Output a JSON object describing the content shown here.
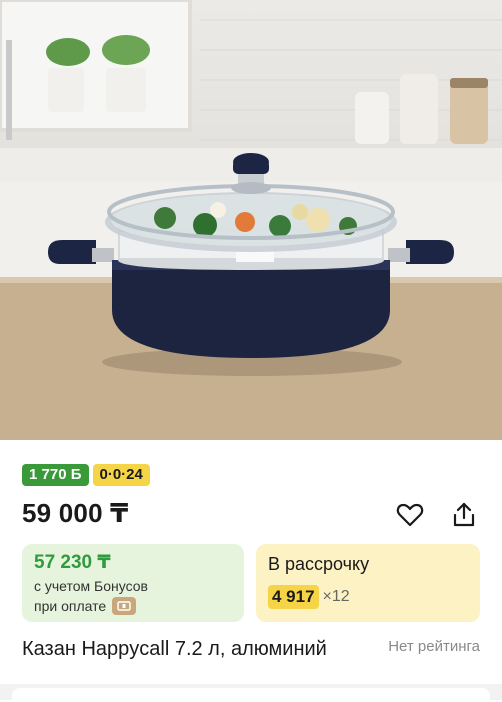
{
  "product": {
    "image_alt": "",
    "badges": [
      {
        "label": "1 770 Б"
      },
      {
        "label": "0·0·24"
      }
    ],
    "price": "59 000 ₸",
    "bonus_card": {
      "price": "57 230 ₸",
      "note_line1": "с учетом Бонусов",
      "note_line2": "при оплате"
    },
    "installment_card": {
      "title": "В рассрочку",
      "amount": "4 917",
      "term": "×12"
    },
    "title": "Казан Happycall 7.2 л, алюминий",
    "rating": "Нет рейтинга"
  },
  "icons": {
    "favorite": "heart-icon",
    "share": "share-icon",
    "payment": "wallet-icon"
  },
  "colors": {
    "bonus_green": "#3a9a3a",
    "bonus_price_green": "#2f9b3c",
    "installment_yellow": "#f5d547",
    "bonus_card_bg": "#e6f4dd",
    "installment_card_bg": "#fdf2c4"
  }
}
